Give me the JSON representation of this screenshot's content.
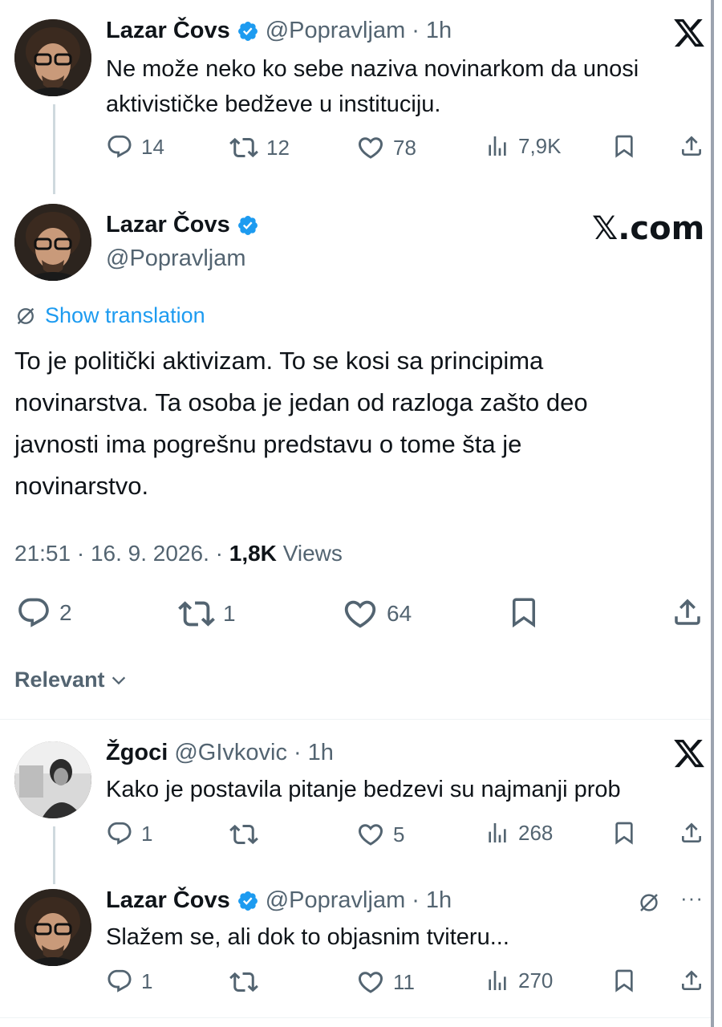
{
  "tweet1": {
    "name": "Lazar Čovs",
    "handle": "@Popravljam",
    "time": "1h",
    "text_line1": "Ne može neko ko sebe naziva novinarkom da unosi",
    "text_line2": "aktivističke bedževe u instituciju.",
    "replies": "14",
    "reposts": "12",
    "likes": "78",
    "views": "7,9K"
  },
  "main": {
    "name": "Lazar Čovs",
    "handle": "@Popravljam",
    "brand": "𝕏.com",
    "translate_label": "Show translation",
    "text_lines": [
      "To je politički aktivizam. To se kosi sa principima",
      "novinarstva. Ta osoba je jedan od razloga zašto deo",
      "javnosti ima pogrešnu predstavu o tome šta je",
      "novinarstvo."
    ],
    "timestamp": "21:51 · 16. 9. 2026. ·",
    "views_count": "1,8K",
    "views_label": "Views",
    "replies": "2",
    "reposts": "1",
    "likes": "64"
  },
  "sort": {
    "label": "Relevant"
  },
  "reply1": {
    "name": "Žgoci",
    "handle": "@GIvkovic",
    "time": "1h",
    "text": "Kako je postavila pitanje bedzevi su najmanji prob",
    "replies": "1",
    "likes": "5",
    "views": "268"
  },
  "reply2": {
    "name": "Lazar Čovs",
    "handle": "@Popravljam",
    "time": "1h",
    "text": "Slažem se, ali dok to objasnim tviteru...",
    "replies": "1",
    "likes": "11",
    "views": "270"
  },
  "colors": {
    "accent": "#1d9bf0",
    "text": "#0f1419",
    "secondary": "#536471",
    "divider": "#eff3f4"
  }
}
